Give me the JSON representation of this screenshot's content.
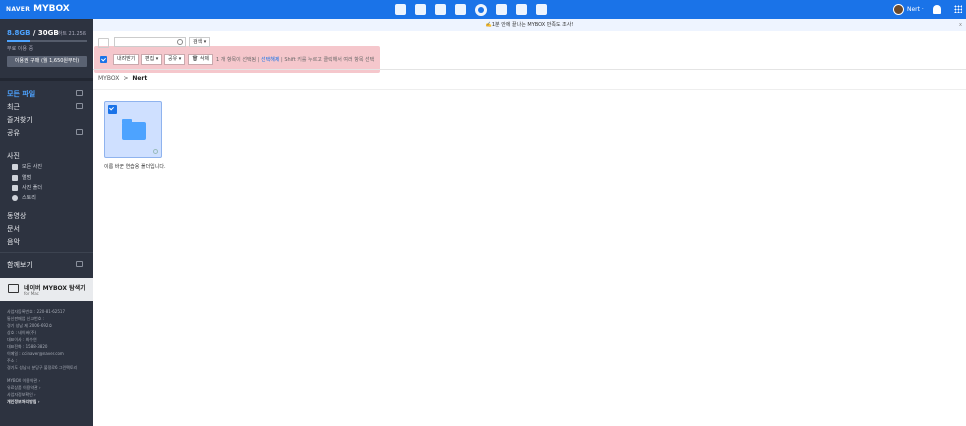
{
  "topbar": {
    "brand_naver": "NAVER",
    "brand_mybox": "MYBOX",
    "user_name": "Nert ·"
  },
  "sidebar": {
    "used": "8.8GB",
    "total": " / 30GB",
    "expire": "하트 21.25ß",
    "storage_ratio": 0.29,
    "free_label": "무료 이용 중",
    "buy_button": "이용권 구매 (월 1,650원부터)",
    "nav": [
      {
        "label": "모든 파일",
        "active": true
      },
      {
        "label": "최근"
      },
      {
        "label": "즐겨찾기"
      },
      {
        "label": "공유"
      },
      {
        "label": "사진"
      },
      {
        "label": "동영상"
      },
      {
        "label": "문서"
      },
      {
        "label": "음악"
      },
      {
        "label": "함께보기"
      }
    ],
    "photo_sub": [
      "모든 사진",
      "앨범",
      "사진 폴더",
      "스토리"
    ],
    "promo_title": "네이버 MYBOX 탐색기",
    "promo_sub": "for Mac",
    "footer": [
      "사업자등록번호 : 220-81-62517",
      "통신판매업 신고번호 :",
      "경기 성남 제 2006-692호",
      "상호 : 네이버(주)",
      "대표이사 : 최수연",
      "대표전화 : 1588-3820",
      "이메일 : ccinaver@naver.com",
      "주소 :",
      "경기도 성남시 분당구 불정로6 그린팩토리",
      "",
      "MYBOX 이용약관 ›",
      "유료상품 이용약관 ›",
      "사업자정보확인 ›",
      "개인정보처리방침 ›"
    ]
  },
  "banner": {
    "text": "✍️1분 안에 끝나는 MYBOX 만족도 조사!",
    "close": "x"
  },
  "toolbar": {
    "search_option": "검색 ▾",
    "download": "내려받기",
    "edit": "편집 ▾",
    "share": "공유 ▾",
    "delete": "🗑 삭제",
    "selection_text": "1 개 항목이 선택됨",
    "deselect": "선택해제",
    "hint": "Shift 키를 누르고 클릭해서 여러 항목 선택"
  },
  "breadcrumb": {
    "root": "MYBOX",
    "sep": ">",
    "current": "Nert"
  },
  "items": [
    {
      "name": "이름 바꾼 연습용 폴더입니다."
    }
  ],
  "colors": {
    "brand": "#1a73e8",
    "sidebar": "#2d3340",
    "highlight": "#f5c7cc"
  }
}
